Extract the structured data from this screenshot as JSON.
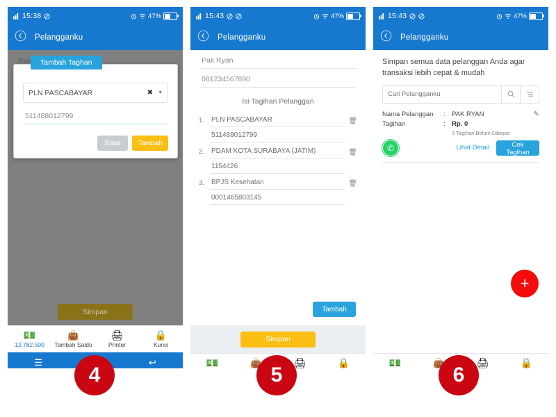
{
  "statusbar": {
    "time_1": "15:38",
    "time_2": "15:43",
    "time_3": "15:43",
    "signal_icon": "signal-icon",
    "mute_icon": "mute-icon",
    "alarm_icon": "alarm-icon",
    "wifi_icon": "wifi-icon",
    "battery_pct": "47%",
    "battery_icon": "battery-icon"
  },
  "appbar": {
    "back_icon": "chevron-left-circle-icon",
    "title": "Pelangganku"
  },
  "panel1": {
    "ghost_name": "Pak Ryan",
    "dialog": {
      "tab_label": "Tambah Taghan",
      "select_value": "PLN PASCABAYAR",
      "clear_icon": "close-icon",
      "caret_icon": "chevron-down-icon",
      "input_value": "511488012799",
      "cancel_label": "Batal",
      "add_label": "Tambah"
    },
    "save_label": "Simpan"
  },
  "panel2": {
    "name_value": "Pak Ryan",
    "phone_value": "081234567890",
    "section_title": "Isi Tagihan Pelanggan",
    "bills": [
      {
        "index": "1.",
        "product": "PLN PASCABAYAR",
        "number": "511488012799",
        "delete_icon": "trash-icon"
      },
      {
        "index": "2.",
        "product": "PDAM KOTA SURABAYA (JATIM)",
        "number": "1154426",
        "delete_icon": "trash-icon"
      },
      {
        "index": "3.",
        "product": "BPJS Kesehatan",
        "number": "0001465803145",
        "delete_icon": "trash-icon"
      }
    ],
    "add_label": "Tambah",
    "save_label": "Simpan"
  },
  "panel3": {
    "intro": "Simpan semua data pelanggan Anda agar transaksi lebih cepat & mudah",
    "search_placeholder": "Cari Pelangganku",
    "search_value": "",
    "search_icon": "search-icon",
    "filter_icon": "filter-list-icon",
    "card": {
      "name_key": "Nama Pelanggan",
      "separator": ":",
      "name_value": "PAK RYAN",
      "bill_key": "Tagihan",
      "bill_value": "Rp. 0",
      "note": "3 Tagihan Belum Dibayar",
      "edit_icon": "edit-icon",
      "whatsapp_icon": "whatsapp-icon",
      "detail_label": "Lihat Detail",
      "check_label": "Cek Tagihan"
    },
    "fab_icon": "plus-icon",
    "fab_label": "+"
  },
  "toolbar": {
    "balance": "12.782.500",
    "balance_icon": "money-icon",
    "topup_label": "Tambah Saldo",
    "topup_icon": "wallet-icon",
    "printer_label": "Printer",
    "printer_icon": "printer-icon",
    "lock_label": "Kunci",
    "lock_icon": "lock-icon"
  },
  "navbar": {
    "menu_icon": "hamburger-menu-icon",
    "menu_glyph": "☰",
    "back_icon": "back-arrow-icon",
    "back_glyph": "↩"
  },
  "badges": {
    "step4": "4",
    "step5": "5",
    "step6": "6"
  },
  "colors": {
    "brand_blue": "#1778d0",
    "accent_blue": "#29a3dd",
    "amber": "#fbbf14",
    "badge_red": "#ca0613",
    "fab_red": "#f40b0b",
    "scrim_gray": "#808080"
  }
}
